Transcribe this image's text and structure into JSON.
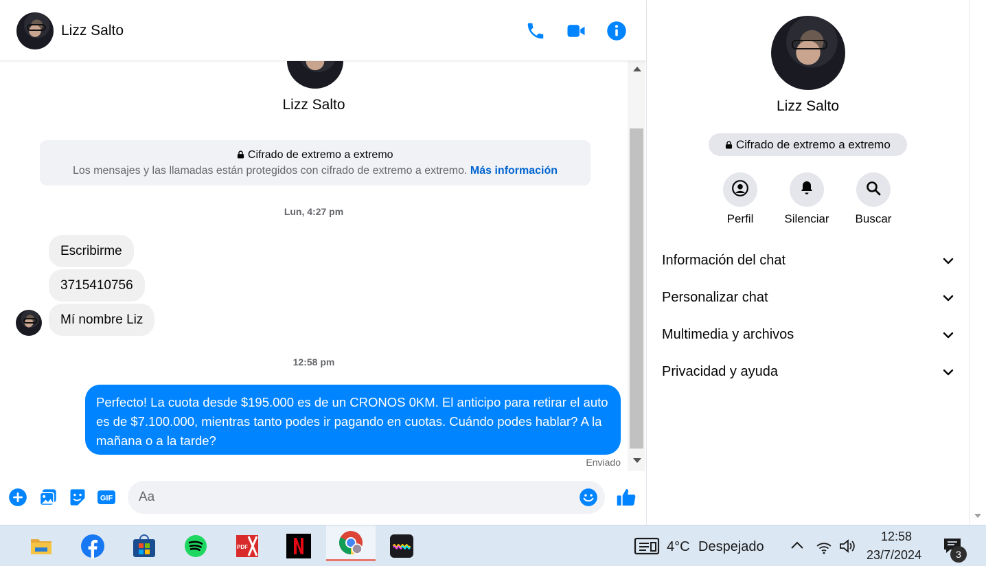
{
  "header": {
    "contact_name": "Lizz Salto",
    "icons": [
      "phone-icon",
      "video-camera-icon",
      "info-icon"
    ]
  },
  "thread": {
    "contact_name": "Lizz Salto",
    "e2e_title": "Cifrado de extremo a extremo",
    "e2e_description": "Los mensajes y las llamadas están protegidos con cifrado de extremo a extremo.",
    "e2e_more_link": "Más información",
    "timestamp_1": "Lun, 4:27 pm",
    "incoming": [
      "Escribirme",
      "3715410756",
      "Mí nombre Liz"
    ],
    "timestamp_2": "12:58 pm",
    "outgoing": "Perfecto! La cuota desde $195.000 es de un CRONOS 0KM. El anticipo para retirar el auto es de $7.100.000, mientras tanto podes ir pagando en cuotas. Cuándo podes hablar? A la mañana o a la tarde?",
    "sent_status": "Enviado"
  },
  "composer": {
    "placeholder": "Aa",
    "gif_label": "GIF",
    "icons": [
      "plus-icon",
      "image-icon",
      "sticker-icon",
      "gif-icon",
      "emoji-icon",
      "thumbs-up-icon"
    ]
  },
  "info_panel": {
    "contact_name": "Lizz Salto",
    "e2e_badge": "Cifrado de extremo a extremo",
    "actions": [
      {
        "label": "Perfil",
        "icon": "profile-icon"
      },
      {
        "label": "Silenciar",
        "icon": "bell-icon"
      },
      {
        "label": "Buscar",
        "icon": "search-icon"
      }
    ],
    "sections": [
      "Información del chat",
      "Personalizar chat",
      "Multimedia y archivos",
      "Privacidad y ayuda"
    ]
  },
  "taskbar": {
    "apps": [
      "file-explorer",
      "facebook",
      "microsoft-store",
      "spotify",
      "pdf-x",
      "netflix",
      "chrome",
      "app-waveform"
    ],
    "pdf_label": "PDF",
    "weather_temp": "4°C",
    "weather_desc": "Despejado",
    "time": "12:58",
    "date": "23/7/2024",
    "notification_count": "3"
  },
  "colors": {
    "messenger_blue": "#0084ff",
    "link_blue": "#0064d1",
    "bubble_gray": "#f0f0f0"
  }
}
